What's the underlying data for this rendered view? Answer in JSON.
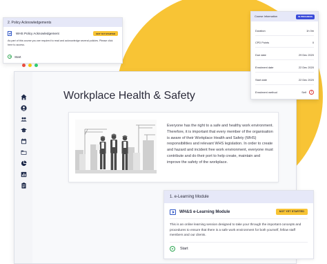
{
  "colors": {
    "accent_yellow": "#f8c435",
    "accent_blue": "#2f56c6",
    "success_green": "#2aa44f",
    "danger_red": "#d93838"
  },
  "window_dots": [
    "#e84c3d",
    "#f1c40f",
    "#2ecc71"
  ],
  "sidebar": {
    "items": [
      {
        "icon": "home-icon"
      },
      {
        "icon": "user-icon"
      },
      {
        "icon": "users-icon"
      },
      {
        "icon": "graduation-cap-icon"
      },
      {
        "icon": "calendar-icon"
      },
      {
        "icon": "folder-icon"
      },
      {
        "icon": "pie-chart-icon"
      },
      {
        "icon": "bar-chart-icon"
      },
      {
        "icon": "clipboard-icon"
      }
    ]
  },
  "page": {
    "title": "Workplace Health & Safety"
  },
  "hero": {
    "image_icon": "construction-workers-illustration",
    "text": "Everyone has the right to a safe and healthy work environment. Therefore, it is important that every member of the organisation is aware of their Workplace Health and Safety (WHS) responsibilities and relevant WHS legislation. In order to create and hazard and incident free work environment, everyone must contribute and do their port to help create, maintain and improve the safety of the workplace."
  },
  "module": {
    "header": "1. e-Learning Module",
    "name": "WH&S e-Learning Module",
    "status": "NOT YET STARTED",
    "description": "This is an online learning session designed to take your through the important concepts and procedures to ensure that there is a safe work environment for both yourself, fellow staff members and our clients.",
    "start_label": "Start"
  },
  "policy": {
    "header": "2. Policy Acknowledgements",
    "name": "WHS Policy Acknowledgement",
    "status": "NOT YET STARTED",
    "description": "As part of this course you are required to read and acknowledge several policies. Please click here to access.",
    "start_label": "Start"
  },
  "course_info": {
    "title": "Course Information",
    "status": "IN PROGRESS",
    "rows": [
      {
        "label": "Duration",
        "value": "1h 0m"
      },
      {
        "label": "CPD Points",
        "value": "0"
      },
      {
        "label": "Due date",
        "value": "29 Dec 2020"
      },
      {
        "label": "Enrolment date",
        "value": "22 Dec 2020"
      },
      {
        "label": "Start date",
        "value": "22 Dec 2020"
      },
      {
        "label": "Enrolment method",
        "value": "Self"
      }
    ]
  }
}
